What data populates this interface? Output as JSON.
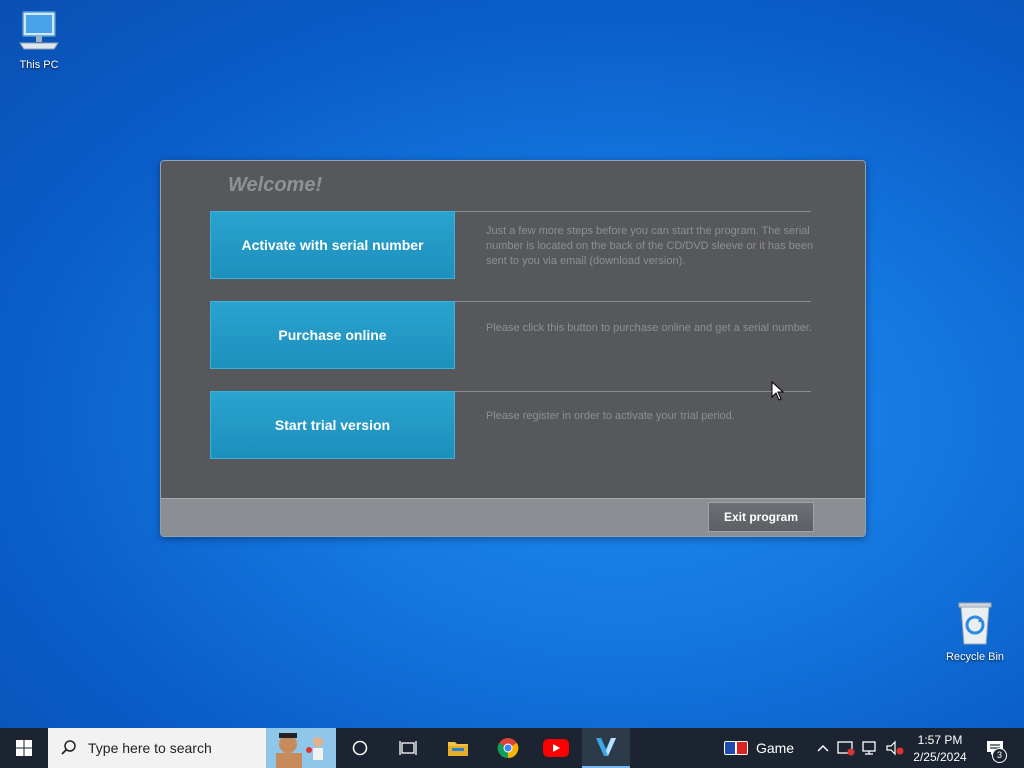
{
  "desktop": {
    "this_pc_label": "This PC",
    "recycle_bin_label": "Recycle Bin"
  },
  "dialog": {
    "welcome": "Welcome!",
    "actions": [
      {
        "label": "Activate with serial number",
        "description": "Just a few more steps before you can start the program. The serial number is located on the back of the CD/DVD sleeve or it has been sent to you via email (download version)."
      },
      {
        "label": "Purchase online",
        "description": "Please click this button to purchase online and get a serial number."
      },
      {
        "label": "Start trial version",
        "description": "Please register in order to activate your trial period."
      }
    ],
    "exit_label": "Exit program"
  },
  "taskbar": {
    "search_placeholder": "Type here to search",
    "game_label": "Game",
    "time": "1:57 PM",
    "date": "2/25/2024",
    "notification_count": "3"
  },
  "colors": {
    "accent_button": "#1d8fbd",
    "dialog_bg": "#57585b",
    "taskbar_bg": "#1b2430"
  }
}
